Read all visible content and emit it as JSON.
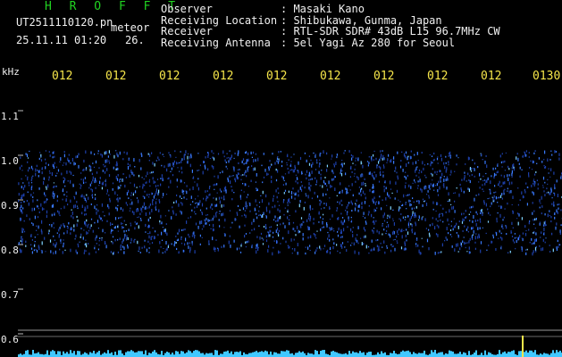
{
  "header": {
    "logo": "H R O F F T",
    "filename": "UT2511110120.pn",
    "type_label": "meteor",
    "datetime": "25.11.11 01:20",
    "count": "26."
  },
  "info": [
    {
      "label": "Observer",
      "value": ": Masaki Kano"
    },
    {
      "label": "Receiving Location",
      "value": ": Shibukawa, Gunma, Japan"
    },
    {
      "label": "Receiver",
      "value": ": RTL-SDR SDR# 43dB L15 96.7MHz CW"
    },
    {
      "label": "Receiving Antenna",
      "value": ": 5el Yagi Az 280 for Seoul"
    }
  ],
  "axis": {
    "unit": "kHz",
    "y_ticks": [
      "1.1",
      "1.0",
      "0.9",
      "0.8",
      "0.7",
      "0.6"
    ],
    "time_ticks": [
      "012",
      "012",
      "012",
      "012",
      "012",
      "012",
      "012",
      "012",
      "012",
      "0130"
    ]
  },
  "colors": {
    "logo": "#21d321",
    "time_ticks": "#f6e64a",
    "signal": "#3a7bff",
    "baseline_noise": "#40c8ff",
    "spike": "#f6e64a"
  }
}
